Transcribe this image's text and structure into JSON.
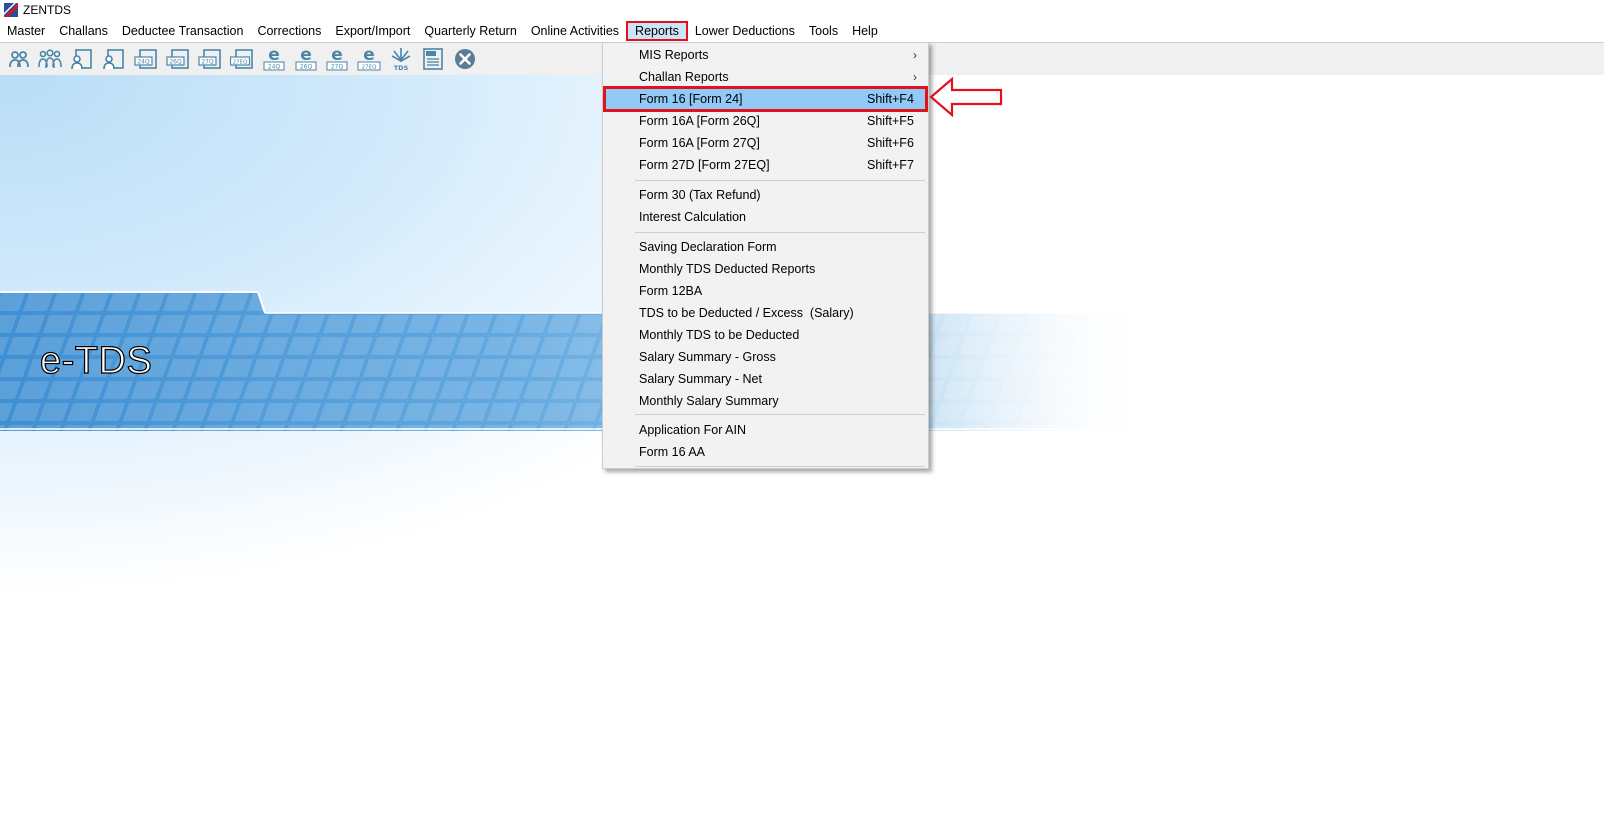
{
  "window": {
    "title": "ZENTDS"
  },
  "menubar": {
    "items": [
      "Master",
      "Challans",
      "Deductee Transaction",
      "Corrections",
      "Export/Import",
      "Quarterly Return",
      "Online Activities",
      "Reports",
      "Lower Deductions",
      "Tools",
      "Help"
    ],
    "active": "Reports"
  },
  "toolbar": {
    "buttons": [
      {
        "icon": "user-icon"
      },
      {
        "icon": "users-group-icon"
      },
      {
        "icon": "user-document-icon"
      },
      {
        "icon": "user-document-icon"
      },
      {
        "icon": "form-24q-document-icon",
        "text": "24Q"
      },
      {
        "icon": "form-26q-document-icon",
        "text": "26Q"
      },
      {
        "icon": "form-27q-document-icon",
        "text": "27Q"
      },
      {
        "icon": "form-27eq-document-icon",
        "text": "27EQ"
      },
      {
        "icon": "e-return-24q-icon",
        "text": "24Q"
      },
      {
        "icon": "e-return-26q-icon",
        "text": "26Q"
      },
      {
        "icon": "e-return-27q-icon",
        "text": "27Q"
      },
      {
        "icon": "e-return-27eq-icon",
        "text": "27EQ"
      },
      {
        "icon": "tds-emblem-icon",
        "text": "TDS"
      },
      {
        "icon": "pdf-document-icon"
      },
      {
        "icon": "close-circle-icon"
      }
    ]
  },
  "banner": {
    "text": "e-TDS"
  },
  "reports_menu": {
    "items": [
      {
        "label": "MIS Reports",
        "submenu": true
      },
      {
        "label": "Challan Reports",
        "submenu": true
      },
      {
        "label": "Form 16 [Form 24]",
        "shortcut": "Shift+F4",
        "highlighted": true
      },
      {
        "label": "Form 16A [Form 26Q]",
        "shortcut": "Shift+F5"
      },
      {
        "label": "Form 16A [Form 27Q]",
        "shortcut": "Shift+F6"
      },
      {
        "label": "Form 27D [Form 27EQ]",
        "shortcut": "Shift+F7"
      },
      {
        "separator": true
      },
      {
        "label": "Form 30 (Tax Refund)"
      },
      {
        "label": "Interest Calculation"
      },
      {
        "separator": true
      },
      {
        "label": "Saving Declaration Form"
      },
      {
        "label": "Monthly TDS Deducted Reports"
      },
      {
        "label": "Form 12BA"
      },
      {
        "label": "TDS to be Deducted / Excess  (Salary)"
      },
      {
        "label": "Monthly TDS to be Deducted"
      },
      {
        "label": "Salary Summary - Gross"
      },
      {
        "label": "Salary Summary - Net"
      },
      {
        "label": "Monthly Salary Summary"
      },
      {
        "separator": true
      },
      {
        "label": "Application For AIN"
      },
      {
        "label": "Form 16 AA"
      },
      {
        "separator": true
      }
    ]
  },
  "annotations": {
    "arrow_icon": "red-left-arrow-icon",
    "highlight_color": "#e0131c"
  },
  "colors": {
    "menu_hover": "#cce4f7",
    "selected_item": "#91c9f7",
    "icon_blue": "#4a86a8"
  }
}
